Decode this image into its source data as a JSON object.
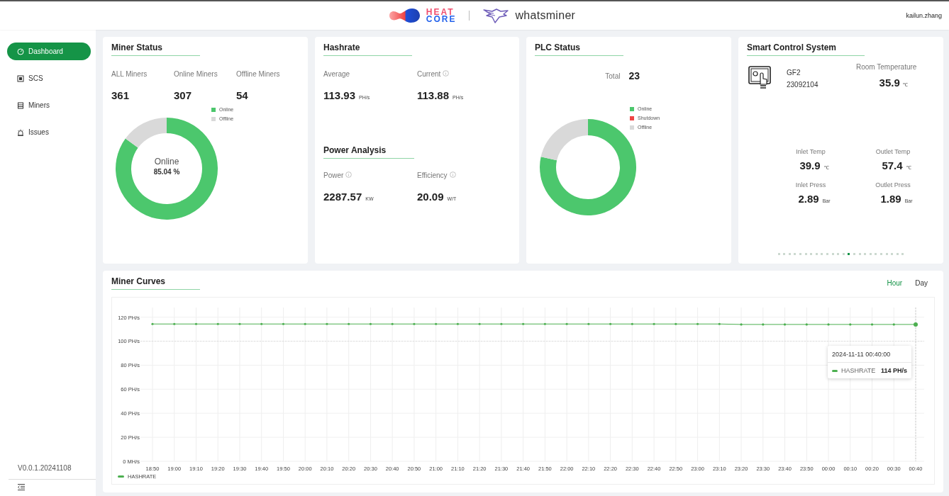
{
  "header": {
    "brand_lines": [
      "HEAT",
      "CORE"
    ],
    "partner": "whatsminer",
    "user": "kailun.zhang"
  },
  "sidebar": {
    "items": [
      {
        "label": "Dashboard",
        "selected": true
      },
      {
        "label": "SCS",
        "selected": false
      },
      {
        "label": "Miners",
        "selected": false
      },
      {
        "label": "Issues",
        "selected": false
      }
    ],
    "version": "V0.0.1.20241108"
  },
  "miner_status": {
    "title": "Miner Status",
    "stats": [
      {
        "label": "ALL Miners",
        "value": "361"
      },
      {
        "label": "Online Miners",
        "value": "307"
      },
      {
        "label": "Offline Miners",
        "value": "54"
      }
    ],
    "center_label": "Online",
    "center_value": "85.04 %",
    "chart_data": {
      "type": "donut",
      "categories": [
        "Online",
        "Offline"
      ],
      "values": [
        85.04,
        14.96
      ],
      "colors": [
        "#4cc76d",
        "#d9d9d9"
      ]
    }
  },
  "hashrate": {
    "title": "Hashrate",
    "stats": [
      {
        "label": "Average",
        "value": "113.93",
        "unit": "PH/s",
        "info": false
      },
      {
        "label": "Current",
        "value": "113.88",
        "unit": "PH/s",
        "info": true
      }
    ]
  },
  "power_analysis": {
    "title": "Power Analysis",
    "stats": [
      {
        "label": "Power",
        "value": "2287.57",
        "unit": "KW",
        "info": true
      },
      {
        "label": "Efficiency",
        "value": "20.09",
        "unit": "W/T",
        "info": true
      }
    ]
  },
  "plc_status": {
    "title": "PLC Status",
    "total_label": "Total",
    "total_value": "23",
    "legend": [
      {
        "label": "Online",
        "color": "#4cc76d"
      },
      {
        "label": "Shutdown",
        "color": "#ef4444"
      },
      {
        "label": "Offline",
        "color": "#d9d9d9"
      }
    ]
  },
  "smart_control": {
    "title": "Smart Control System",
    "device_name": "GF2",
    "device_id": "23092104",
    "room_label": "Room Temperature",
    "room_value": "35.9",
    "room_unit": "℃",
    "readings": [
      {
        "label": "Inlet Temp",
        "value": "39.9",
        "unit": "℃"
      },
      {
        "label": "Outlet Temp",
        "value": "57.4",
        "unit": "℃"
      },
      {
        "label": "Inlet Press",
        "value": "2.89",
        "unit": "Bar"
      },
      {
        "label": "Outlet Press",
        "value": "1.89",
        "unit": "Bar"
      }
    ],
    "pages": [
      {
        "selected": false
      },
      {
        "selected": false
      },
      {
        "selected": false
      },
      {
        "selected": false
      },
      {
        "selected": false
      },
      {
        "selected": false
      },
      {
        "selected": false
      },
      {
        "selected": false
      },
      {
        "selected": false
      },
      {
        "selected": false
      },
      {
        "selected": false
      },
      {
        "selected": false
      },
      {
        "selected": false
      },
      {
        "selected": true
      },
      {
        "selected": false
      },
      {
        "selected": false
      },
      {
        "selected": false
      },
      {
        "selected": false
      },
      {
        "selected": false
      },
      {
        "selected": false
      },
      {
        "selected": false
      },
      {
        "selected": false
      },
      {
        "selected": false
      },
      {
        "selected": false
      }
    ]
  },
  "miner_curves": {
    "title": "Miner Curves",
    "ranges": [
      {
        "label": "Hour",
        "selected": true
      },
      {
        "label": "Day",
        "selected": false
      }
    ],
    "tooltip": {
      "title": "2024-11-11 00:40:00",
      "series": "HASHRATE",
      "value": "114 PH/s"
    },
    "chart_data": {
      "type": "line",
      "categories": [
        "18:50",
        "19:00",
        "19:10",
        "19:20",
        "19:30",
        "19:40",
        "19:50",
        "20:00",
        "20:10",
        "20:20",
        "20:30",
        "20:40",
        "20:50",
        "21:00",
        "21:10",
        "21:20",
        "21:30",
        "21:40",
        "21:50",
        "22:00",
        "22:10",
        "22:20",
        "22:30",
        "22:40",
        "22:50",
        "23:00",
        "23:10",
        "23:20",
        "23:30",
        "23:40",
        "23:50",
        "00:00",
        "00:10",
        "00:20",
        "00:30",
        "00:40"
      ],
      "series": [
        {
          "name": "HASHRATE",
          "color": "#4caf50",
          "values": [
            114.3,
            114.3,
            114.3,
            114.3,
            114.3,
            114.3,
            114.3,
            114.3,
            114.3,
            114.3,
            114.3,
            114.3,
            114.3,
            114.3,
            114.3,
            114.3,
            114.3,
            114.3,
            114.3,
            114.3,
            114.3,
            114.3,
            114.3,
            114.3,
            114.3,
            114.3,
            114.3,
            113.9,
            113.9,
            113.9,
            113.9,
            113.9,
            113.9,
            113.9,
            113.9,
            113.9
          ]
        }
      ],
      "ylim": [
        0,
        128
      ],
      "grid": true,
      "ref_lines": [
        {
          "axis": "y",
          "value": 100
        },
        {
          "axis": "x",
          "value": "00:40"
        }
      ],
      "yticks": [
        {
          "value": 0,
          "label": "0 MH/s"
        },
        {
          "value": 20,
          "label": "20 PH/s"
        },
        {
          "value": 40,
          "label": "40 PH/s"
        },
        {
          "value": 60,
          "label": "60 PH/s"
        },
        {
          "value": 80,
          "label": "80 PH/s"
        },
        {
          "value": 100,
          "label": "100 PH/s"
        },
        {
          "value": 120,
          "label": "120 PH/s"
        }
      ]
    }
  }
}
